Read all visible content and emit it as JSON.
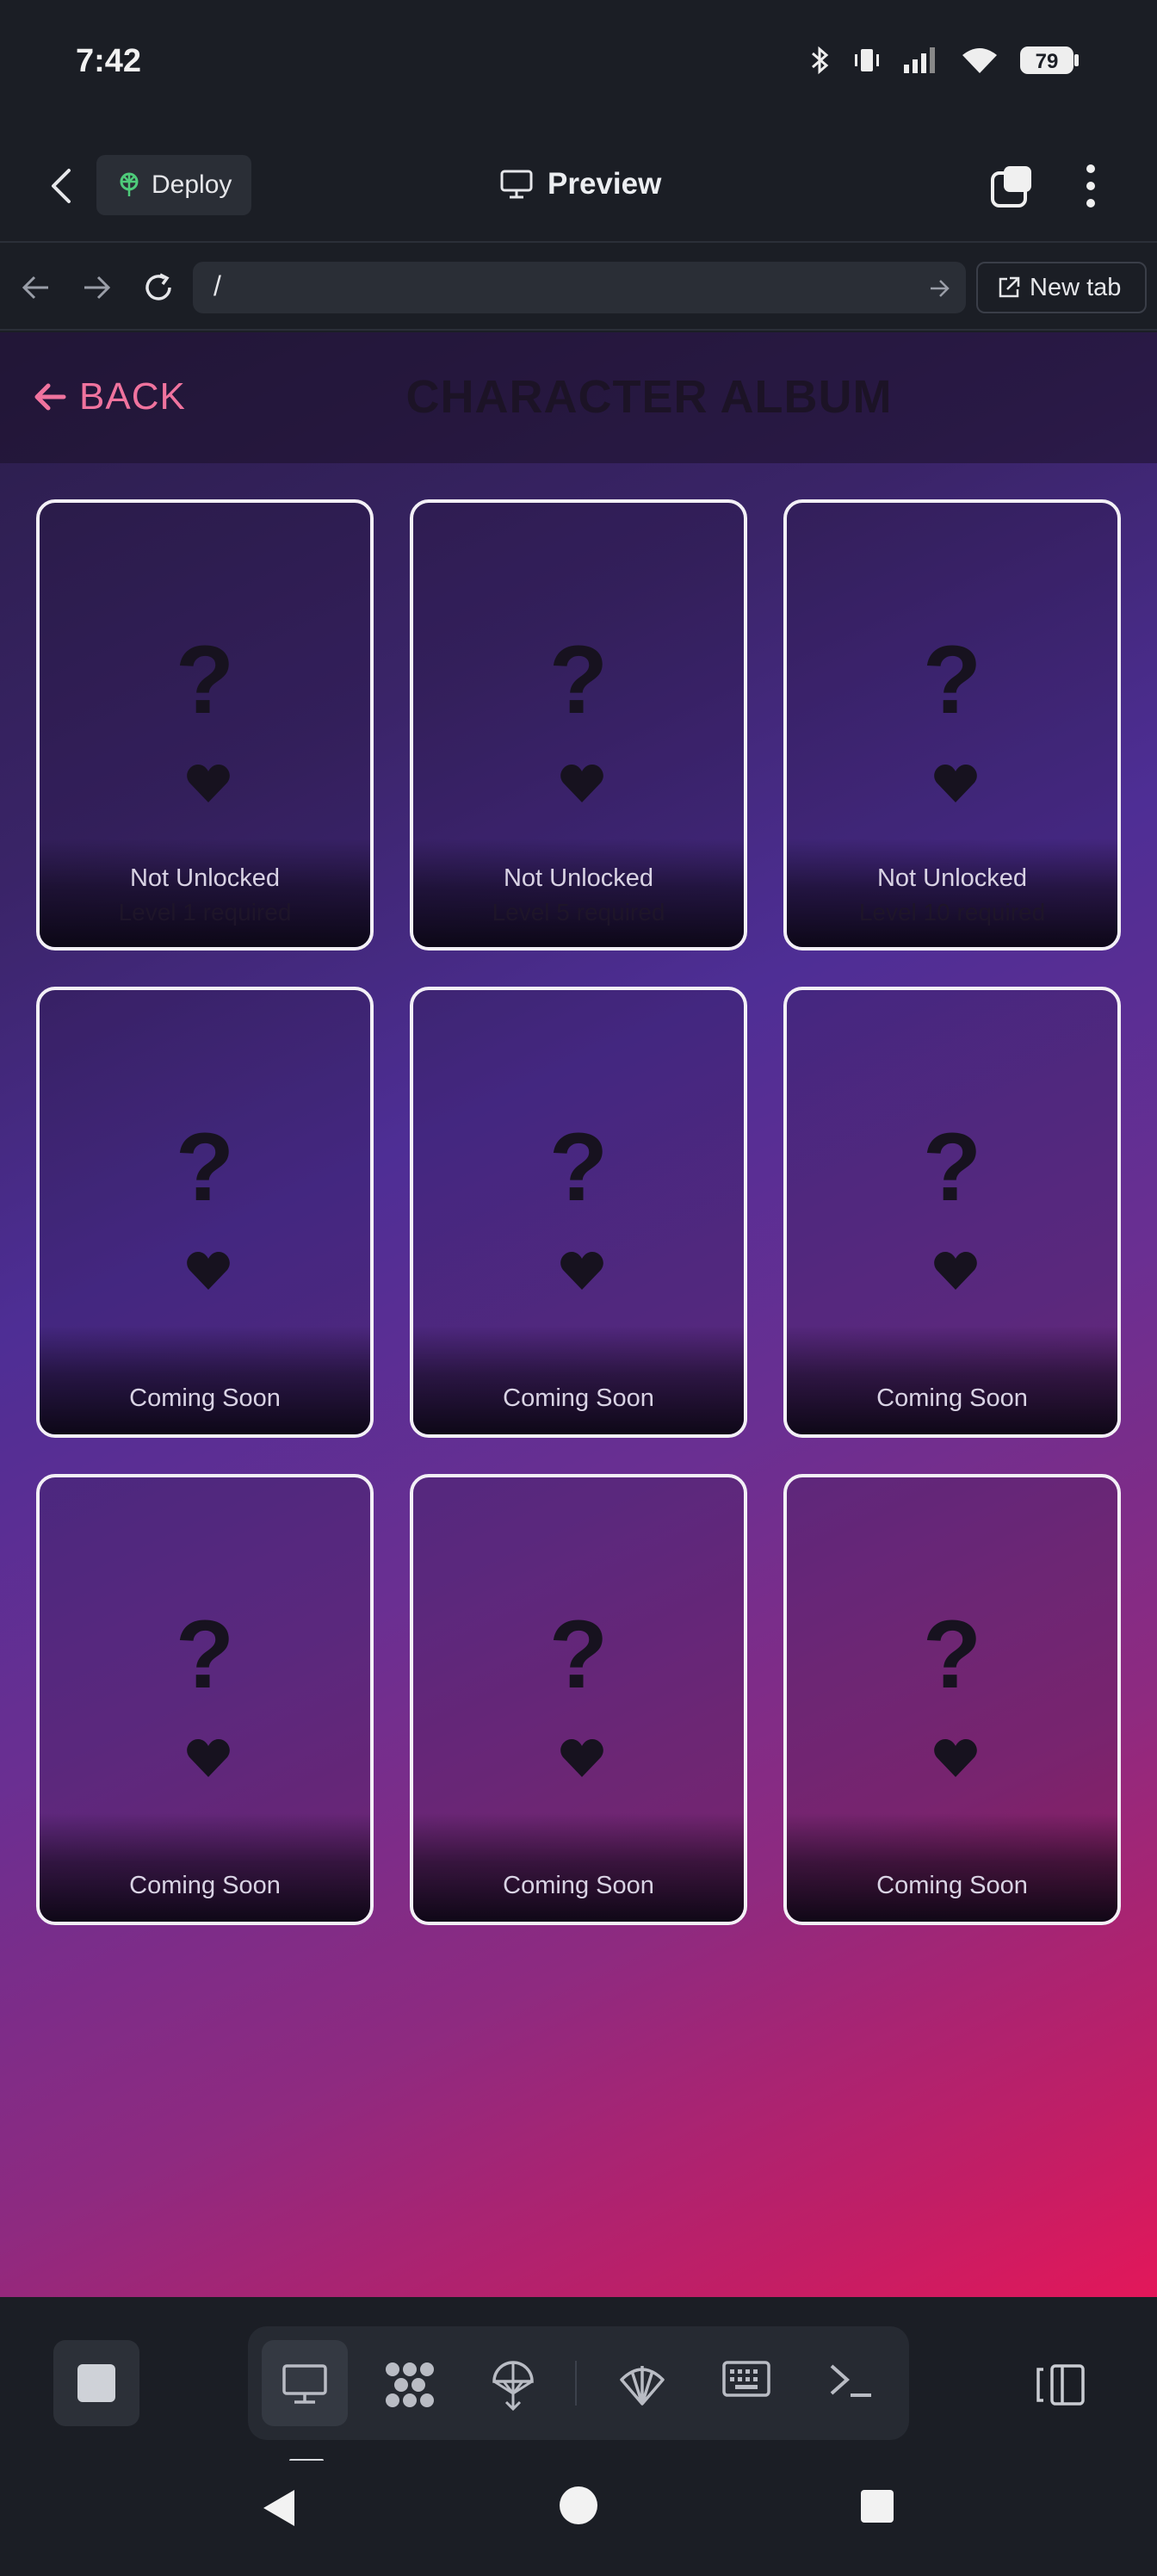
{
  "status_bar": {
    "time": "7:42",
    "battery": "79"
  },
  "app_bar": {
    "deploy_label": "Deploy",
    "title": "Preview"
  },
  "url_bar": {
    "url": "/",
    "new_tab_label": "New tab"
  },
  "page": {
    "back_label": "BACK",
    "title": "CHARACTER ALBUM",
    "cards": [
      {
        "status": "Not Unlocked",
        "requirement": "Level 1 required"
      },
      {
        "status": "Not Unlocked",
        "requirement": "Level 5 required"
      },
      {
        "status": "Not Unlocked",
        "requirement": "Level 10 required"
      },
      {
        "status": "Coming Soon"
      },
      {
        "status": "Coming Soon"
      },
      {
        "status": "Coming Soon"
      },
      {
        "status": "Coming Soon"
      },
      {
        "status": "Coming Soon"
      },
      {
        "status": "Coming Soon"
      }
    ],
    "card_placeholder": "?"
  },
  "colors": {
    "accent": "#f0739e",
    "card_border": "#f3f0f6",
    "gradient_start": "#2a1d49",
    "gradient_end": "#e3175a"
  }
}
